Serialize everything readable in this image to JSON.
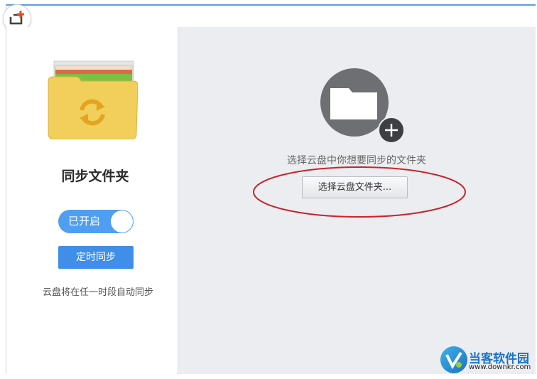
{
  "window": {
    "add_icon": "add-folder-icon"
  },
  "sidebar": {
    "title": "同步文件夹",
    "folder_icon": "sync-folder-icon",
    "toggle_label": "已开启",
    "toggle_on": true,
    "schedule_button": "定时同步",
    "hint": "云盘将在任一时段自动同步"
  },
  "main": {
    "folder_icon": "cloud-folder-icon",
    "plus_icon": "plus-icon",
    "hint": "选择云盘中你想要同步的文件夹",
    "choose_button": "选择云盘文件夹..."
  },
  "watermark": {
    "name": "当客软件园",
    "url": "www.downkr.com"
  },
  "colors": {
    "accent": "#3f8fe8",
    "toggle": "#4e9ff1",
    "annotation": "#c8242b",
    "folder_yellow": "#f2cf5a",
    "main_bg": "#ebedf0"
  }
}
